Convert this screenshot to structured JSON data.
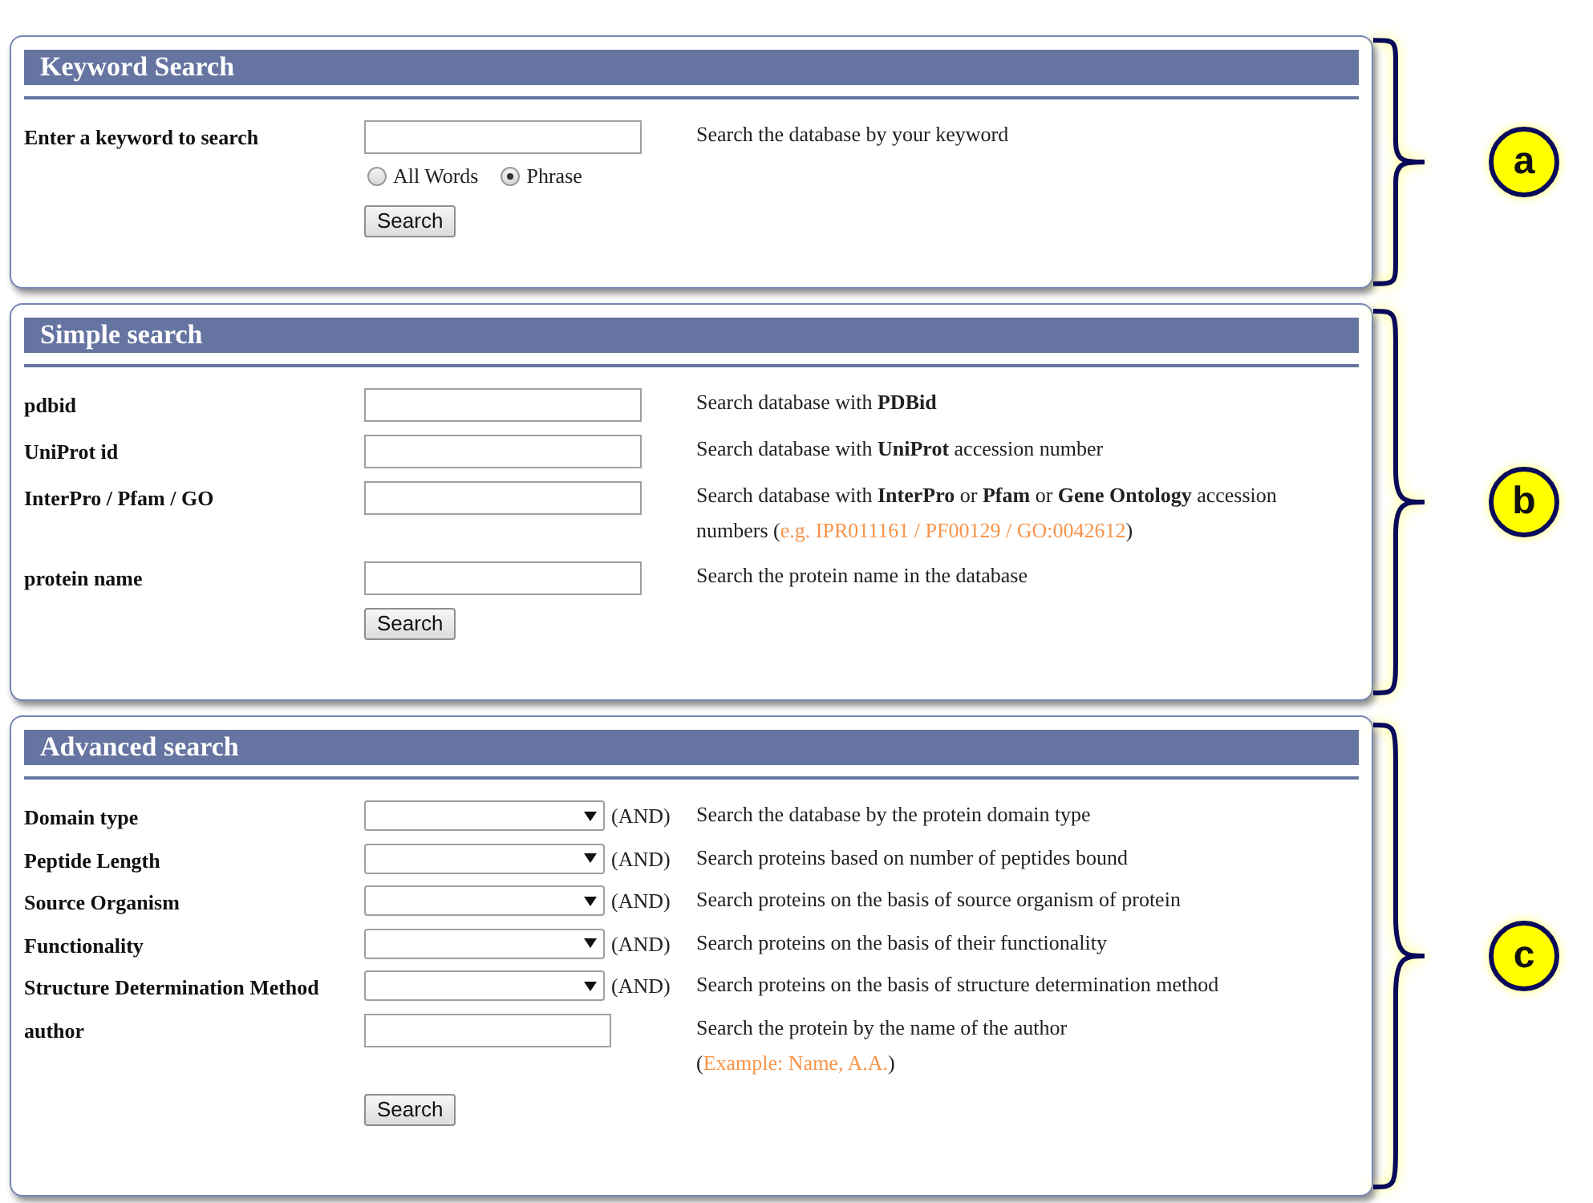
{
  "sections": [
    {
      "marker": "a",
      "title": "Keyword Search",
      "button": "Search",
      "rows": [
        {
          "kind": "text",
          "label": "Enter a keyword to search",
          "description": "Search the database by your keyword",
          "radios": [
            {
              "label": "All Words",
              "selected": false
            },
            {
              "label": "Phrase",
              "selected": true
            }
          ]
        }
      ]
    },
    {
      "marker": "b",
      "title": "Simple search",
      "button": "Search",
      "rows": [
        {
          "kind": "text",
          "label": "pdbid",
          "description": "Search database with **PDBid**"
        },
        {
          "kind": "text",
          "label": "UniProt id",
          "description": "Search database with **UniProt** accession number"
        },
        {
          "kind": "text",
          "label": "InterPro / Pfam / GO",
          "description": "Search database with **InterPro** or **Pfam** or **Gene Ontology** accession numbers",
          "example": {
            "kind": "inline",
            "open": "(",
            "text": "e.g. IPR011161 / PF00129 / GO:0042612",
            "close": ")"
          }
        },
        {
          "kind": "text",
          "label": "protein name",
          "description": "Search the protein name in the database"
        }
      ]
    },
    {
      "marker": "c",
      "title": "Advanced search",
      "button": "Search",
      "rows": [
        {
          "kind": "select",
          "label": "Domain type",
          "operator": "(AND)",
          "description": "Search the database by the protein domain type"
        },
        {
          "kind": "select",
          "label": "Peptide Length",
          "operator": "(AND)",
          "description": "Search proteins based on number of peptides bound"
        },
        {
          "kind": "select",
          "label": "Source Organism",
          "operator": "(AND)",
          "description": "Search proteins on the basis of source organism of protein"
        },
        {
          "kind": "select",
          "label": "Functionality",
          "operator": "(AND)",
          "description": "Search proteins on the basis of their functionality"
        },
        {
          "kind": "select",
          "label": "Structure Determination Method",
          "operator": "(AND)",
          "description": "Search proteins on the basis of structure determination method"
        },
        {
          "kind": "text_narrow",
          "label": "author",
          "description": "Search the protein by the name of the author",
          "example": {
            "kind": "below",
            "open": "(",
            "text": "Example: Name, A.A.",
            "close": ")"
          }
        }
      ]
    }
  ]
}
